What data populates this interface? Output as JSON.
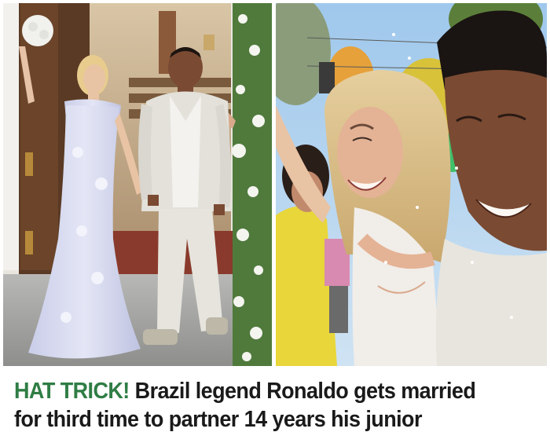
{
  "article": {
    "kicker": "HAT TRICK!",
    "headline_line1": "Brazil legend Ronaldo gets married",
    "headline_line2": "for third time to partner 14 years his junior",
    "kicker_color": "#2f7d45",
    "headline_color": "#1a1a1a"
  },
  "images": {
    "left": "wedding-couple-leaving-church-photo",
    "right": "couple-laughing-confetti-closeup-photo"
  }
}
